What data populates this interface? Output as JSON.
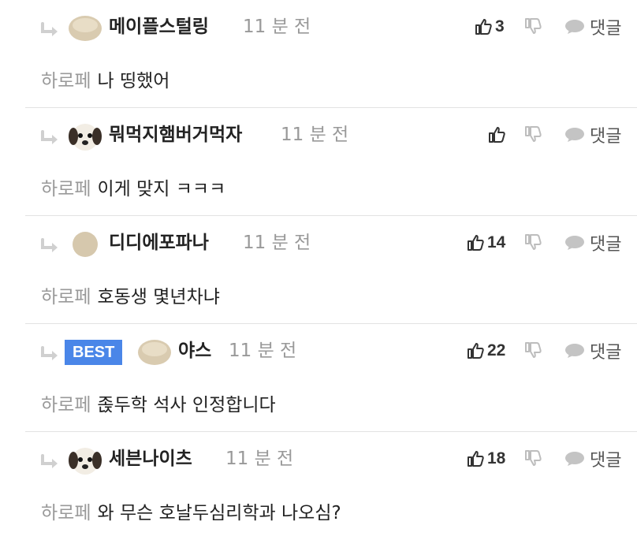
{
  "comments": [
    {
      "nick": "메이플스털링",
      "time": "11 분 전",
      "likes": "3",
      "best": "",
      "reply": "댓글",
      "writer": "하로페",
      "text": "나 띵했어"
    },
    {
      "nick": "뭐먹지햄버거먹자",
      "time": "11 분 전",
      "likes": "",
      "best": "",
      "reply": "댓글",
      "writer": "하로페",
      "text": "이게 맞지 ㅋㅋㅋ"
    },
    {
      "nick": "디디에포파나",
      "time": "11 분 전",
      "likes": "14",
      "best": "",
      "reply": "댓글",
      "writer": "하로페",
      "text": "호동생 몇년차냐"
    },
    {
      "nick": "야스",
      "time": "11 분 전",
      "likes": "22",
      "best": "BEST",
      "reply": "댓글",
      "writer": "하로페",
      "text": "졵두학 석사 인정합니다"
    },
    {
      "nick": "세븐나이츠",
      "time": "11 분 전",
      "likes": "18",
      "best": "",
      "reply": "댓글",
      "writer": "하로페",
      "text": "와 무슨 호날두심리학과 나오심?"
    }
  ],
  "icons": {
    "reply_arrow": "reply-arrow-icon",
    "like": "thumbs-up-icon",
    "dislike": "thumbs-down-icon",
    "reply": "speech-bubble-icon",
    "avatar_plain": "blob-avatar",
    "avatar_dog": "dog-face-avatar"
  },
  "colors": {
    "best_badge": "#4a86e8",
    "muted": "#999999",
    "divider": "#e3e3e3"
  }
}
